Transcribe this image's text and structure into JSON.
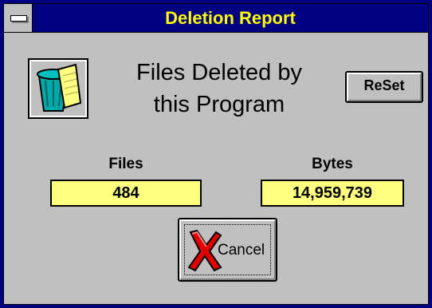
{
  "window": {
    "title": "Deletion Report"
  },
  "icons": {
    "app": "trash-can-icon",
    "system_menu": "system-menu-icon",
    "cancel": "red-x-icon"
  },
  "heading": {
    "line1": "Files Deleted by",
    "line2": "this Program"
  },
  "buttons": {
    "reset_label": "ReSet",
    "cancel_label": "Cancel"
  },
  "stats": {
    "files_label": "Files",
    "files_value": "484",
    "bytes_label": "Bytes",
    "bytes_value": "14,959,739"
  },
  "colors": {
    "titlebar": "#000080",
    "title_text": "#ffff00",
    "field_bg": "#ffff80",
    "face": "#c0c0c0"
  }
}
